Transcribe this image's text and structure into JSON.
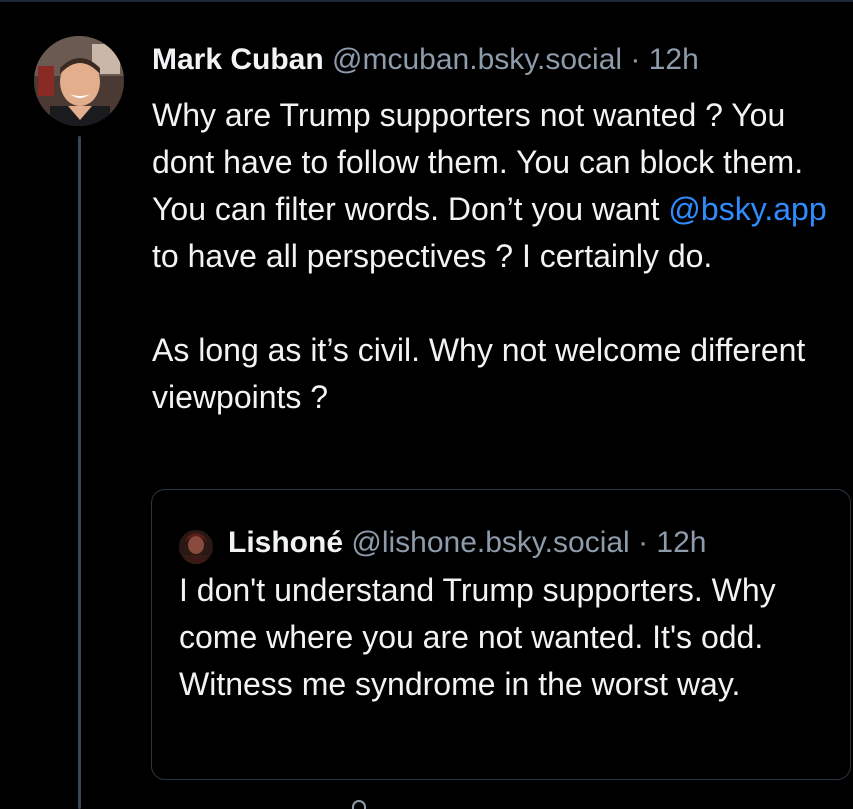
{
  "post": {
    "author": {
      "display_name": "Mark Cuban",
      "handle": "@mcuban.bsky.social",
      "separator": "·",
      "time": "12h",
      "avatar_icon": "avatar-photo"
    },
    "body": {
      "para1_before_mention": "Why are Trump supporters not wanted ? You dont have to follow them.   You can block them.  You can filter words.  Don’t you want ",
      "mention": "@bsky.app",
      "para1_after_mention": " to have all perspectives ? I certainly do.",
      "para2": "As long as it’s civil. Why not welcome different viewpoints ?"
    },
    "quote": {
      "author": {
        "display_name": "Lishoné",
        "handle": "@lishone.bsky.social",
        "separator": "·",
        "time": "12h",
        "avatar_icon": "avatar-photo"
      },
      "text": "I don't understand Trump supporters. Why come where you are not wanted. It's odd. Witness me syndrome in the worst way."
    }
  },
  "colors": {
    "background": "#000000",
    "text_primary": "#f1f3f5",
    "text_secondary": "#8d9bab",
    "link": "#2f8cff",
    "border": "#2b3645",
    "thread_line": "#3a4656"
  }
}
